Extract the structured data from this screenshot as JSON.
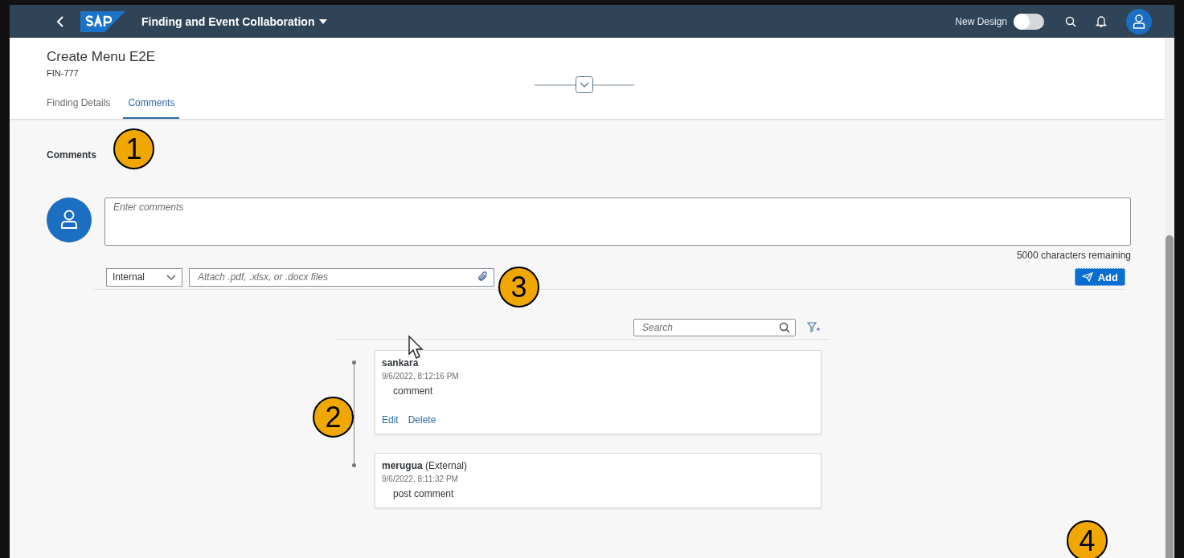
{
  "shell": {
    "title": "Finding and Event Collaboration",
    "new_design": {
      "label": "New Design",
      "on": false
    }
  },
  "header": {
    "title": "Create Menu E2E",
    "subtitle": "FIN-777"
  },
  "tabs": [
    {
      "label": "Finding Details",
      "selected": false
    },
    {
      "label": "Comments",
      "selected": true
    }
  ],
  "section_title": "Comments",
  "composer": {
    "placeholder": "Enter comments",
    "counter": "5000 characters remaining",
    "visibility": "Internal",
    "attach_placeholder": "Attach .pdf, .xlsx, or .docx files",
    "add_button": "Add"
  },
  "feed": {
    "search_placeholder": "Search",
    "comments": [
      {
        "author": "sankara",
        "time": "9/6/2022, 8:12:16 PM",
        "text": "comment",
        "actions": [
          "Edit",
          "Delete"
        ]
      },
      {
        "author": "merugua",
        "role": "(External)",
        "time": "9/6/2022, 8:11:32 PM",
        "text": "post comment"
      }
    ]
  },
  "callouts": [
    "1",
    "2",
    "3",
    "4"
  ]
}
